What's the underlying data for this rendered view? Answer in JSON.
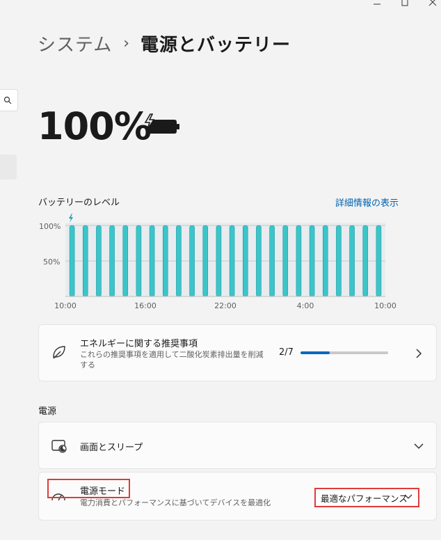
{
  "breadcrumb": {
    "parent": "システム",
    "separator": "›",
    "current": "電源とバッテリー"
  },
  "battery": {
    "percentage": "100%",
    "charging": true
  },
  "level": {
    "title": "バッテリーのレベル",
    "details_link": "詳細情報の表示"
  },
  "chart_data": {
    "type": "bar",
    "title": "バッテリーのレベル",
    "ytick_labels": [
      "100%",
      "50%"
    ],
    "xtick_labels": [
      "10:00",
      "16:00",
      "22:00",
      "4:00",
      "10:00"
    ],
    "ylim": [
      0,
      100
    ],
    "values": [
      100,
      100,
      100,
      100,
      100,
      100,
      100,
      100,
      100,
      100,
      100,
      100,
      100,
      100,
      100,
      100,
      100,
      100,
      100,
      100,
      100,
      100,
      100,
      100
    ],
    "bar_color": "#3cc5c9",
    "grid": true
  },
  "energy": {
    "title": "エネルギーに関する推奨事項",
    "subtitle": "これらの推奨事項を適用して二酸化炭素排出量を削減する",
    "count": "2/7",
    "progress": 0.33
  },
  "power_section": {
    "label": "電源"
  },
  "screen_sleep": {
    "title": "画面とスリープ"
  },
  "power_mode": {
    "title": "電源モード",
    "subtitle": "電力消費とパフォーマンスに基づいてデバイスを最適化",
    "selected": "最適なパフォーマンス"
  },
  "colors": {
    "accent": "#0067c0",
    "link": "#0063b1",
    "highlight": "#e03a3a"
  }
}
